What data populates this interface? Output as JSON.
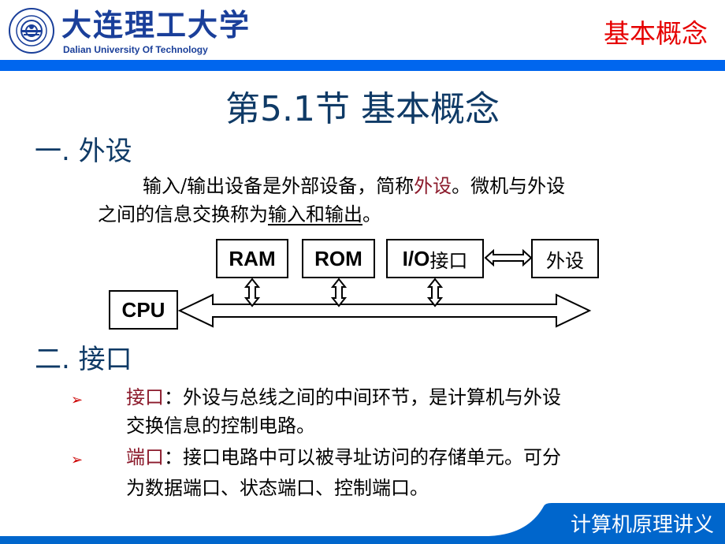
{
  "header": {
    "university_name_cn": "大连理工大学",
    "university_name_en": "Dalian University Of Technology",
    "topic": "基本概念",
    "bar_color": "#0066ee",
    "topic_color": "#e60000"
  },
  "slide": {
    "title": "第5.1节  基本概念",
    "title_color": "#0f3a66",
    "section1": {
      "heading": "一. 外设",
      "paragraph_line1_pre": "输入/输出设备是外部设备，简称",
      "paragraph_line1_highlight": "外设",
      "paragraph_line1_post": "。微机与外设",
      "paragraph_line2_pre": "之间的信息交换称为",
      "paragraph_line2_underlined": "输入和输出",
      "paragraph_line2_post": "。"
    },
    "diagram": {
      "boxes": {
        "ram": "RAM",
        "rom": "ROM",
        "io_latin": "I/O",
        "io_cn": "接口",
        "peripheral": "外设",
        "cpu": "CPU"
      }
    },
    "section2": {
      "heading": "二. 接口",
      "bullets": [
        {
          "icon": "arrowhead-bullet-icon",
          "term": "接口",
          "line1": "：外设与总线之间的中间环节，是计算机与外设",
          "line2": "交换信息的控制电路。"
        },
        {
          "icon": "arrowhead-bullet-icon",
          "term": "端口",
          "line1": "：接口电路中可以被寻址访问的存储单元。可分",
          "line2": "为数据端口、状态端口、控制端口。"
        }
      ],
      "highlight_color": "#8b1a2b"
    }
  },
  "footer": {
    "label": "计算机原理讲义",
    "color": "#0066cc"
  }
}
